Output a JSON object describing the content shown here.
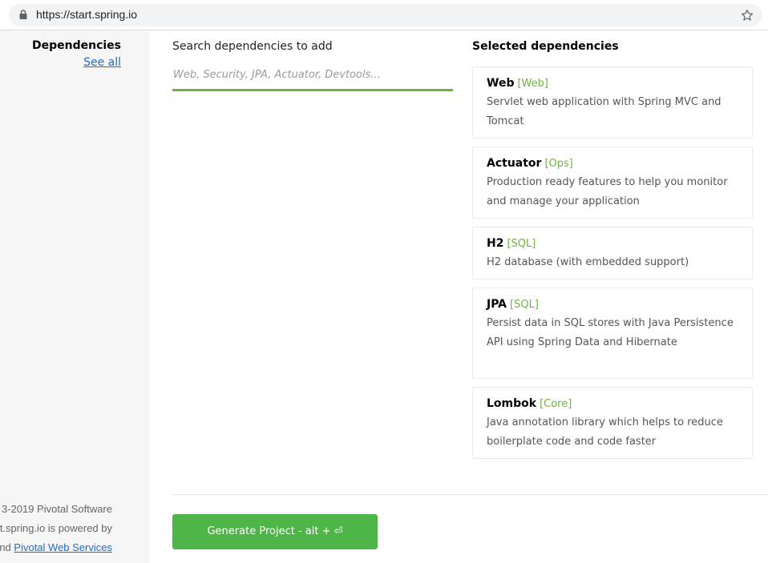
{
  "browser": {
    "url": "https://start.spring.io"
  },
  "sidebar": {
    "heading": "Dependencies",
    "see_all": "See all",
    "footer": {
      "line1": "3-2019 Pivotal Software",
      "line2": "t.spring.io is powered by",
      "line3_prefix": "nd ",
      "line3_link": "Pivotal Web Services"
    }
  },
  "search": {
    "label": "Search dependencies to add",
    "placeholder": "Web, Security, JPA, Actuator, Devtools...",
    "value": ""
  },
  "selected": {
    "heading": "Selected dependencies",
    "items": [
      {
        "name": "Web",
        "tag": "[Web]",
        "description": "Servlet web application with Spring MVC and Tomcat"
      },
      {
        "name": "Actuator",
        "tag": "[Ops]",
        "description": "Production ready features to help you monitor and manage your application"
      },
      {
        "name": "H2",
        "tag": "[SQL]",
        "description": "H2 database (with embedded support)"
      },
      {
        "name": "JPA",
        "tag": "[SQL]",
        "description": "Persist data in SQL stores with Java Persistence API using Spring Data and Hibernate"
      },
      {
        "name": "Lombok",
        "tag": "[Core]",
        "description": "Java annotation library which helps to reduce boilerplate code and code faster"
      }
    ]
  },
  "actions": {
    "generate_label": "Generate Project - alt + ⏎"
  },
  "colors": {
    "spring_green": "#6db33f",
    "button_green": "#4db646",
    "link_blue": "#1a6cd1"
  }
}
